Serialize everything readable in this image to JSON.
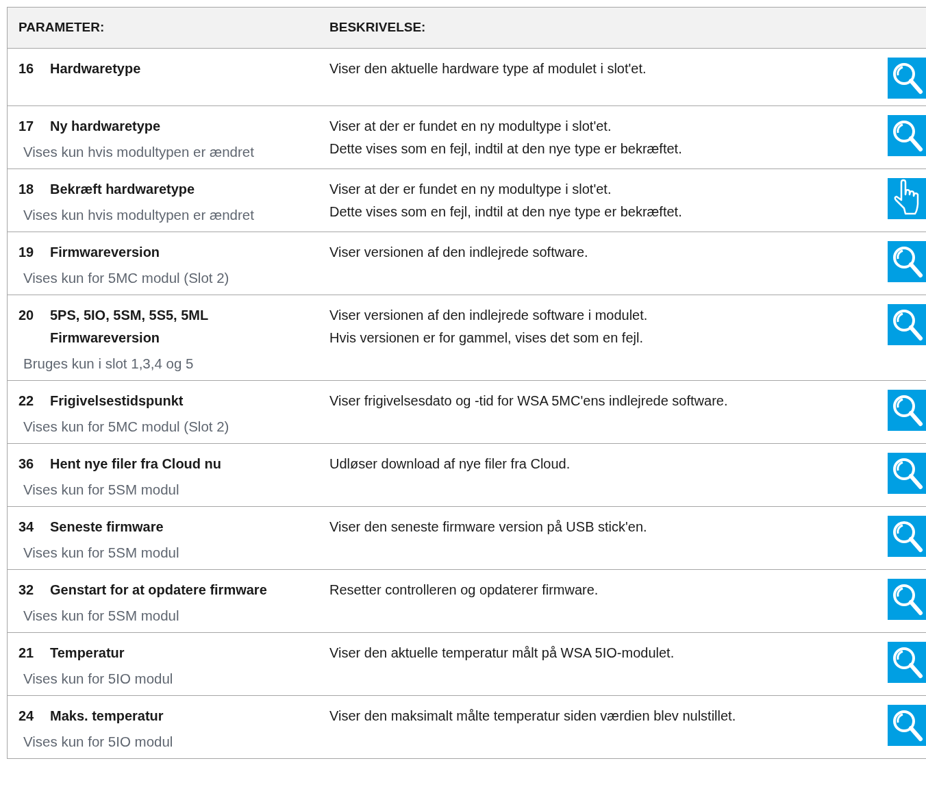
{
  "table": {
    "columns": [
      "PARAMETER:",
      "BESKRIVELSE:"
    ],
    "rows": [
      {
        "number": "16",
        "name": "Hardwaretype",
        "description": [
          "Viser den aktuelle hardware type af modulet i slot'et."
        ],
        "kind": "view"
      },
      {
        "number": "17",
        "name": "Ny hardwaretype",
        "note": "Vises kun hvis modultypen er ændret",
        "description": [
          "Viser at der er fundet en ny modultype i slot'et.",
          "Dette vises som en fejl, indtil at den nye type er bekræftet."
        ],
        "kind": "view"
      },
      {
        "number": "18",
        "name": "Bekræft hardwaretype",
        "note": "Vises kun hvis modultypen er ændret",
        "description": [
          "Viser at der er fundet en ny modultype i slot'et.",
          "Dette vises som en fejl, indtil at den nye type er bekræftet."
        ],
        "kind": "action"
      },
      {
        "number": "19",
        "name": "Firmwareversion",
        "note": "Vises kun for 5MC modul (Slot 2)",
        "description": [
          "Viser versionen af den indlejrede software."
        ],
        "kind": "view"
      },
      {
        "number": "20",
        "name": "5PS, 5IO, 5SM, 5S5, 5ML Firmwareversion",
        "note": "Bruges kun i slot 1,3,4 og 5",
        "description": [
          "Viser versionen af den indlejrede software i modulet.",
          "Hvis versionen er for gammel, vises det som en fejl."
        ],
        "kind": "view"
      },
      {
        "number": "22",
        "name": "Frigivelsestidspunkt",
        "note": "Vises kun for 5MC modul (Slot 2)",
        "description": [
          "Viser frigivelsesdato og -tid for WSA 5MC'ens indlejrede software."
        ],
        "kind": "view"
      },
      {
        "number": "36",
        "name": "Hent nye filer fra Cloud nu",
        "note": "Vises kun for 5SM modul",
        "description": [
          "Udløser download af nye filer fra Cloud."
        ],
        "kind": "view"
      },
      {
        "number": "34",
        "name": "Seneste firmware",
        "note": "Vises kun for 5SM modul",
        "description": [
          "Viser den seneste firmware version på USB stick'en."
        ],
        "kind": "view"
      },
      {
        "number": "32",
        "name": "Genstart for at opdatere firmware",
        "note": "Vises kun for 5SM modul",
        "description": [
          "Resetter controlleren og opdaterer firmware."
        ],
        "kind": "view"
      },
      {
        "number": "21",
        "name": "Temperatur",
        "note": "Vises kun for 5IO modul",
        "description": [
          "Viser den aktuelle temperatur målt på WSA 5IO-modulet."
        ],
        "kind": "view"
      },
      {
        "number": "24",
        "name": "Maks. temperatur",
        "note": "Vises kun for 5IO modul",
        "description": [
          "Viser den maksimalt målte temperatur siden værdien blev nulstillet."
        ],
        "kind": "view"
      }
    ]
  }
}
